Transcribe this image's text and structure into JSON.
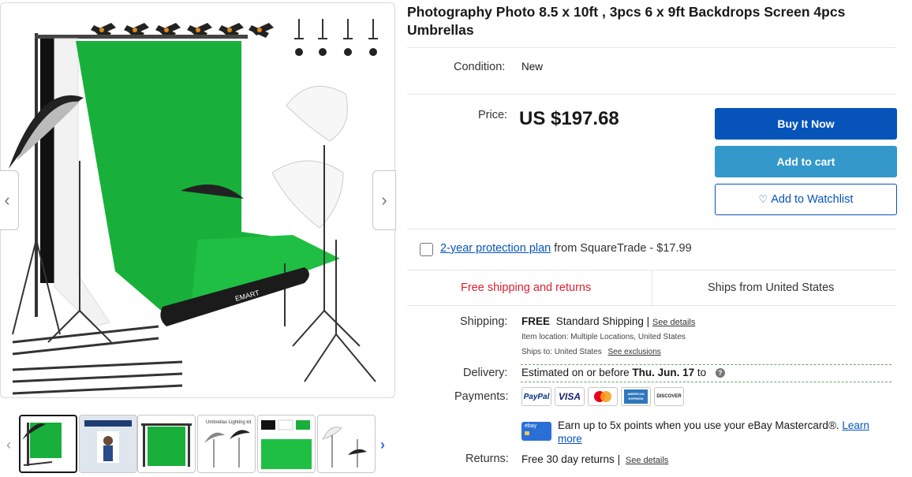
{
  "product": {
    "title": "Photography Photo 8.5 x 10ft , 3pcs 6 x 9ft Backdrops Screen 4pcs Umbrellas",
    "condition_label": "Condition:",
    "condition_value": "New",
    "price_label": "Price:",
    "price": "US $197.68"
  },
  "gallery": {
    "main_image_brand": "EMART",
    "prev_arrow": "‹",
    "next_arrow": "›",
    "thumbs_prev": "‹",
    "thumbs_next": "›",
    "thumb_captions": [
      "",
      "",
      "",
      "Umbrellas Lighting kit",
      "",
      ""
    ]
  },
  "actions": {
    "buy_now": "Buy It Now",
    "add_to_cart": "Add to cart",
    "watchlist_icon": "♡",
    "add_to_watchlist": "Add to Watchlist"
  },
  "protection": {
    "link": "2-year protection plan",
    "rest": " from SquareTrade - $17.99"
  },
  "shipping_box": {
    "free": "Free shipping and returns",
    "ships_from": "Ships from United States"
  },
  "shipping": {
    "label": "Shipping:",
    "free": "FREE",
    "method": "Standard Shipping",
    "separator": "|",
    "see_details": "See details",
    "item_location": "Item location:  Multiple Locations, United States",
    "ships_to_label": "Ships to:  United States",
    "see_exclusions": "See exclusions"
  },
  "delivery": {
    "label": "Delivery:",
    "text": "Estimated on or before ",
    "date": "Thu. Jun. 17",
    "after": " to",
    "help_icon": "?"
  },
  "payments": {
    "label": "Payments:",
    "methods": [
      "PayPal",
      "VISA",
      "Mastercard",
      "AMERICAN EXPRESS",
      "DISCOVER"
    ],
    "card_text": "ebay",
    "promo": "Earn up to 5x points when you use your eBay Mastercard®. ",
    "learn_more": "Learn more"
  },
  "returns": {
    "label": "Returns:",
    "text": "Free 30 day returns",
    "separator": "|",
    "see_details": "See details"
  },
  "colors": {
    "buy_now": "#0654ba",
    "add_to_cart": "#3498ca",
    "free_shipping": "#dd1e31",
    "link": "#0654ba"
  }
}
